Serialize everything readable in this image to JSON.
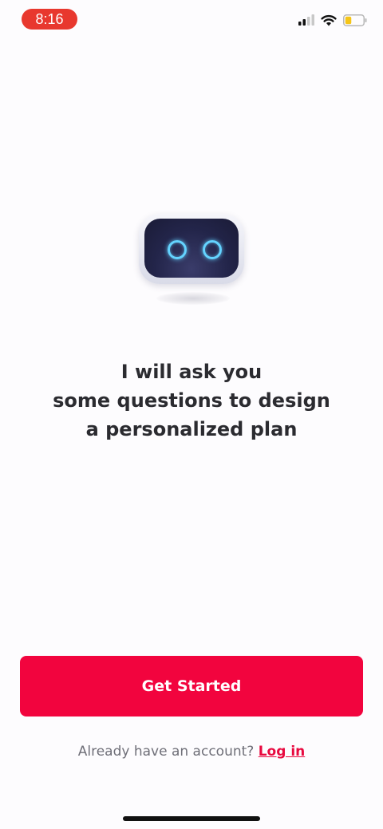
{
  "status_bar": {
    "time": "8:16",
    "icons": [
      "signal-icon",
      "wifi-icon",
      "battery-icon"
    ],
    "battery_level": 0.35,
    "time_pill_color": "#e8382e"
  },
  "hero": {
    "illustration": "robot-icon",
    "headline_lines": [
      "I will ask you",
      "some questions to design",
      "a personalized plan"
    ]
  },
  "actions": {
    "primary_label": "Get Started",
    "primary_color": "#f2043e",
    "account_prompt": "Already have an account?",
    "login_label": "Log in"
  },
  "colors": {
    "accent": "#f2043e",
    "background": "#fdfcfe",
    "text": "#2b2b30",
    "muted_text": "#6f6f78"
  }
}
